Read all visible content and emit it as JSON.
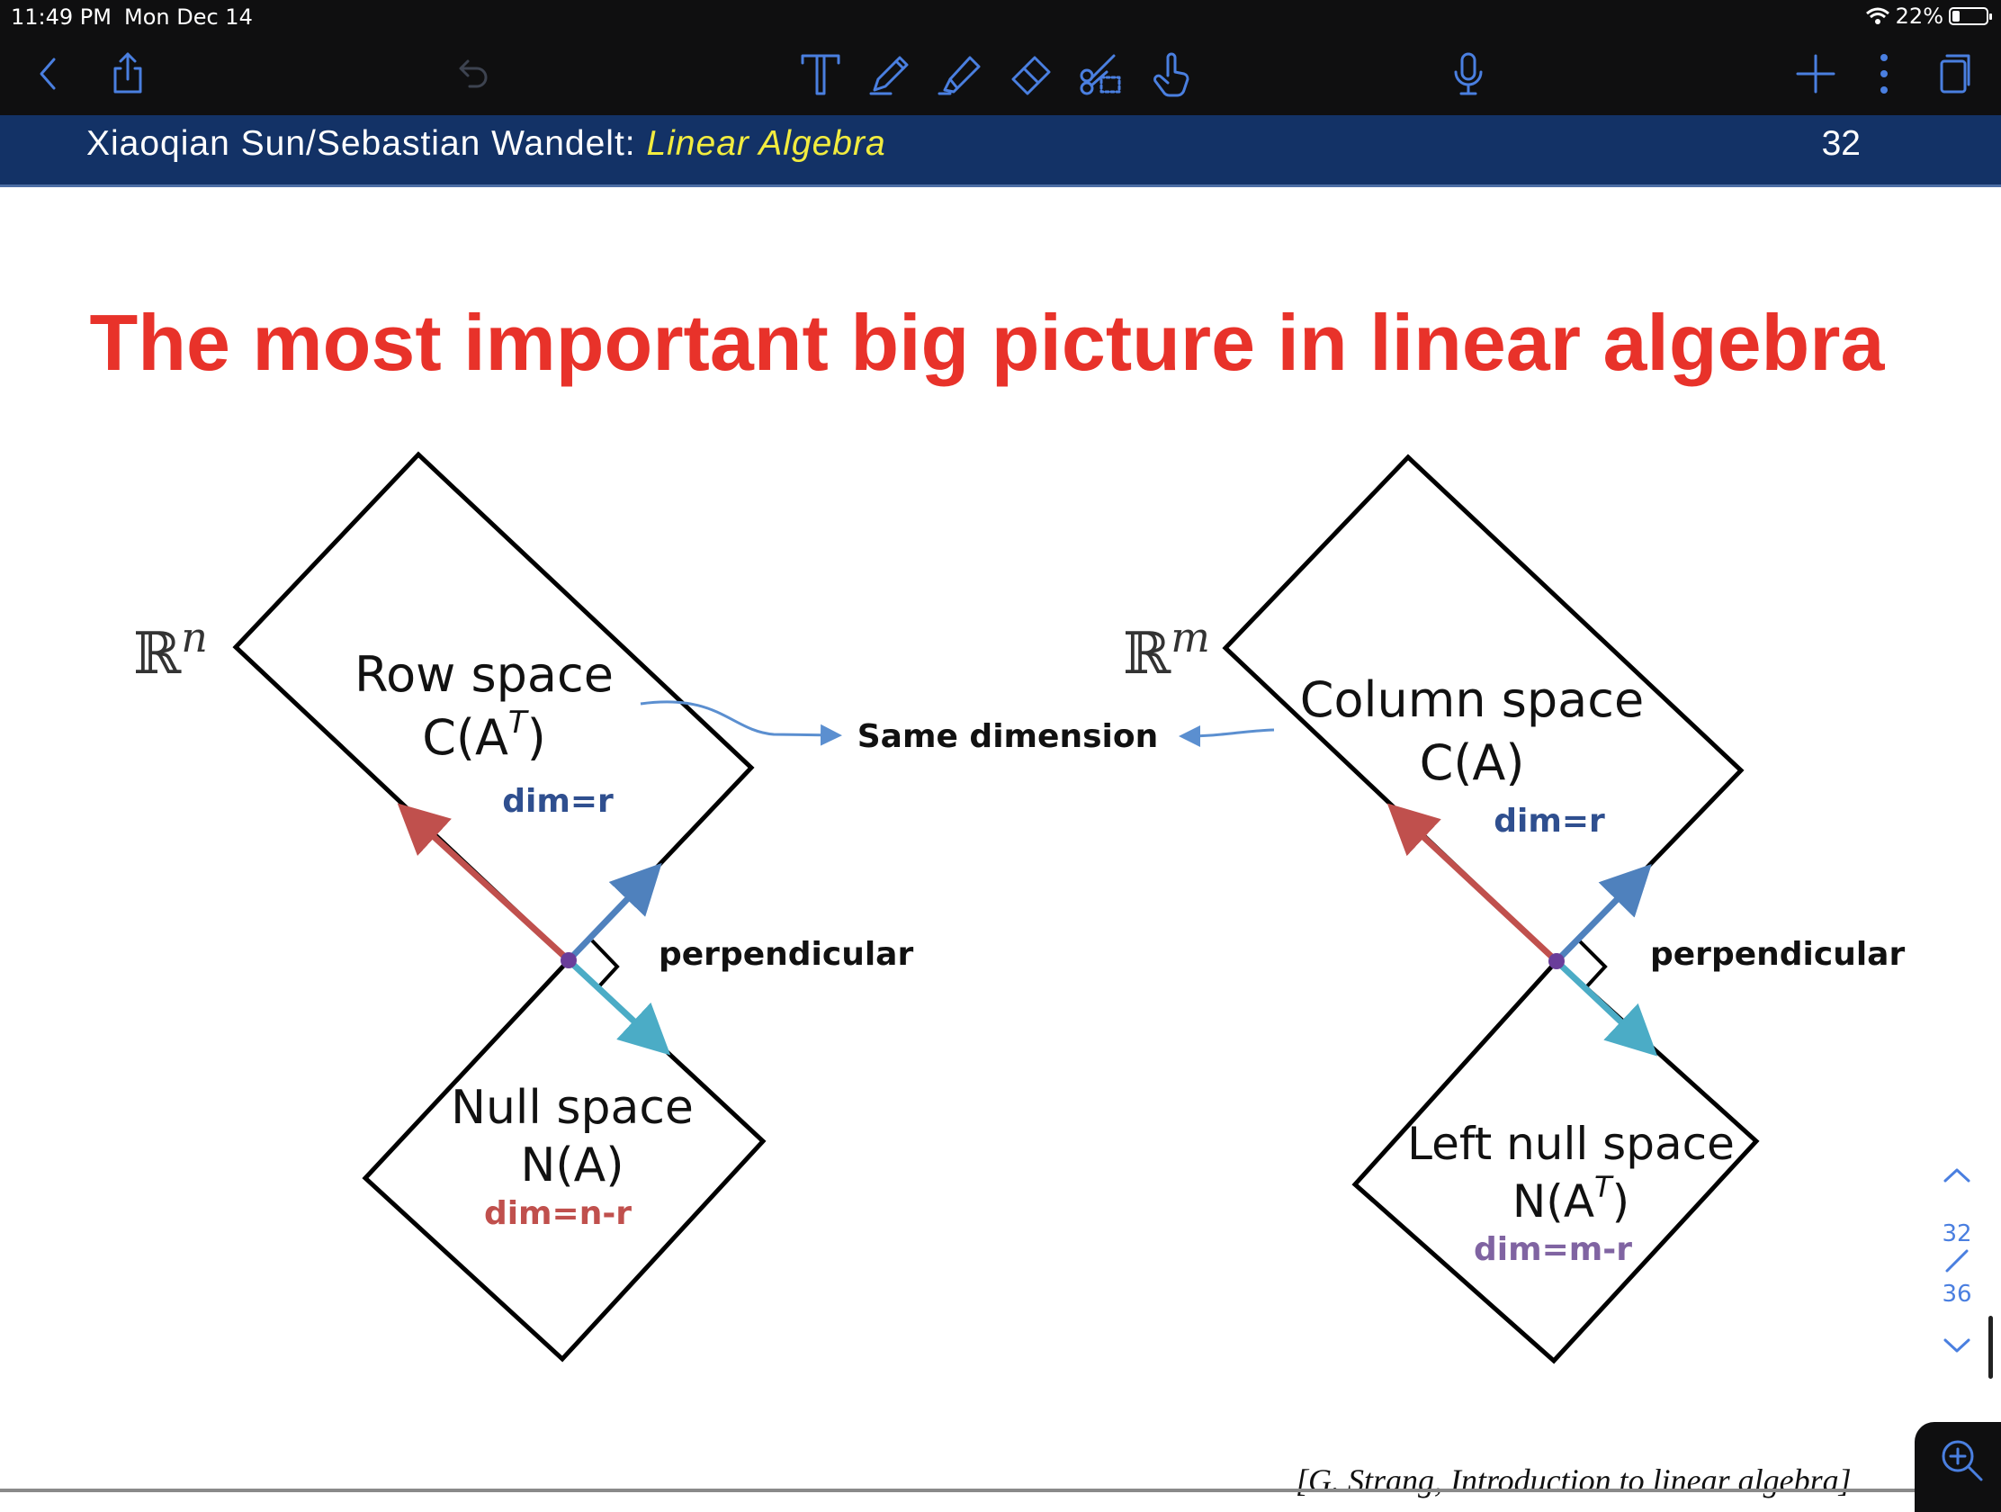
{
  "status": {
    "time": "11:49 PM",
    "date": "Mon Dec 14",
    "battery": "22%",
    "battery_level": 0.22
  },
  "toolbar": {
    "left": [
      {
        "name": "back-icon"
      },
      {
        "name": "share-icon"
      },
      {
        "name": "undo-icon"
      }
    ],
    "tools": [
      {
        "name": "text-tool-icon"
      },
      {
        "name": "pen-tool-icon"
      },
      {
        "name": "highlighter-tool-icon"
      },
      {
        "name": "eraser-tool-icon"
      },
      {
        "name": "lasso-scissors-icon"
      },
      {
        "name": "hand-pointer-icon"
      }
    ],
    "center": [
      {
        "name": "microphone-icon"
      }
    ],
    "right": [
      {
        "name": "add-icon"
      },
      {
        "name": "more-icon"
      },
      {
        "name": "pages-icon"
      }
    ],
    "accent_color": "#4a7fe0"
  },
  "slide_header": {
    "authors": "Xiaoqian Sun/Sebastian Wandelt: ",
    "course": "Linear Algebra",
    "page": "32",
    "bg_color": "#133266",
    "course_color": "#f2ec3f"
  },
  "slide": {
    "title": "The most important big picture in linear algebra",
    "title_color": "#e8322a",
    "middle_label": "Same dimension",
    "citation": "[G. Strang, Introduction to linear algebra]",
    "left": {
      "space_label": "ℝ",
      "space_exp": "n",
      "upper_name": "Row space",
      "upper_formula": "C(A",
      "upper_formula_sup": "T",
      "upper_formula_end": ")",
      "upper_dim": "dim=r",
      "lower_name": "Null space",
      "lower_formula": "N(A)",
      "lower_dim": "dim=n-r",
      "perp": "perpendicular"
    },
    "right": {
      "space_label": "ℝ",
      "space_exp": "m",
      "upper_name": "Column space",
      "upper_formula": "C(A)",
      "upper_dim": "dim=r",
      "lower_name": "Left null space",
      "lower_formula": "N(A",
      "lower_formula_sup": "T",
      "lower_formula_end": ")",
      "lower_dim": "dim=m-r",
      "perp": "perpendicular"
    },
    "colors": {
      "upper_dim": "#2f4f8f",
      "lower_dim_left": "#c0504d",
      "lower_dim_right": "#8064a2",
      "row_arrow": "#c0504d",
      "col_arrow": "#4f81bd",
      "null_arrow": "#4bacc6",
      "pointer": "#5b8fd0"
    }
  },
  "pager": {
    "current": "32",
    "total": "36"
  }
}
